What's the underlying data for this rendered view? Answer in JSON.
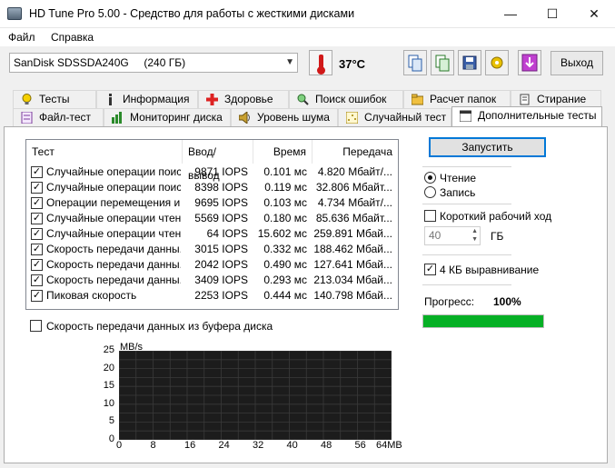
{
  "window": {
    "title": "HD Tune Pro 5.00 - Средство для работы с жесткими дисками",
    "minimize_glyph": "—",
    "maximize_glyph": "☐",
    "close_glyph": "✕"
  },
  "menu": [
    "Файл",
    "Справка"
  ],
  "toolbar": {
    "drive": "SanDisk SDSSDA240G     (240 ГБ)",
    "temperature": "37°C",
    "buttons": [
      "copy-icon",
      "copy-screenshot-icon",
      "save-icon",
      "options-icon",
      "download-icon"
    ],
    "exit_label": "Выход"
  },
  "tabs_row1": [
    "Тесты",
    "Информация",
    "Здоровье",
    "Поиск ошибок",
    "Расчет папок",
    "Стирание"
  ],
  "tabs_row2": [
    "Файл-тест",
    "Мониторинг диска",
    "Уровень шума",
    "Случайный тест",
    "Дополнительные тесты"
  ],
  "table": {
    "headers": [
      "Тест",
      "Ввод/вывод",
      "Время",
      "Передача"
    ],
    "rows": [
      {
        "test": "Случайные операции поис...",
        "io": "9871 IOPS",
        "time": "0.101 мс",
        "transfer": "4.820 Мбайт/..."
      },
      {
        "test": "Случайные операции поис...",
        "io": "8398 IOPS",
        "time": "0.119 мс",
        "transfer": "32.806 Мбайт..."
      },
      {
        "test": "Операции перемещения и...",
        "io": "9695 IOPS",
        "time": "0.103 мс",
        "transfer": "4.734 Мбайт/..."
      },
      {
        "test": "Случайные операции чтени...",
        "io": "5569 IOPS",
        "time": "0.180 мс",
        "transfer": "85.636 Мбайт..."
      },
      {
        "test": "Случайные операции чтени...",
        "io": "64 IOPS",
        "time": "15.602 мс",
        "transfer": "259.891 Мбай..."
      },
      {
        "test": "Скорость передачи данны...",
        "io": "3015 IOPS",
        "time": "0.332 мс",
        "transfer": "188.462 Мбай..."
      },
      {
        "test": "Скорость передачи данны...",
        "io": "2042 IOPS",
        "time": "0.490 мс",
        "transfer": "127.641 Мбай..."
      },
      {
        "test": "Скорость передачи данны...",
        "io": "3409 IOPS",
        "time": "0.293 мс",
        "transfer": "213.034 Мбай..."
      },
      {
        "test": "Пиковая скорость",
        "io": "2253 IOPS",
        "time": "0.444 мс",
        "transfer": "140.798 Мбай..."
      }
    ]
  },
  "buffer_checkbox": "Скорость передачи данных из буфера диска",
  "controls": {
    "start_label": "Запустить",
    "read_label": "Чтение",
    "write_label": "Запись",
    "short_stroke_label": "Короткий рабочий ход",
    "short_stroke_value": "40",
    "gb_label": "ГБ",
    "align_label": "4 КБ выравнивание",
    "progress_label": "Прогресс:",
    "progress_value": "100%",
    "progress_fraction": 1.0,
    "progress_color": "#06b025"
  },
  "chart_data": {
    "type": "line",
    "ylabel": "MB/s",
    "xlabel": "",
    "y_ticks": [
      "25",
      "20",
      "15",
      "10",
      "5",
      "0"
    ],
    "x_ticks": [
      "0",
      "8",
      "16",
      "24",
      "32",
      "40",
      "48",
      "56",
      "64MB"
    ],
    "ylim": [
      0,
      25
    ],
    "xlim": [
      0,
      64
    ],
    "grid": true,
    "series": []
  }
}
